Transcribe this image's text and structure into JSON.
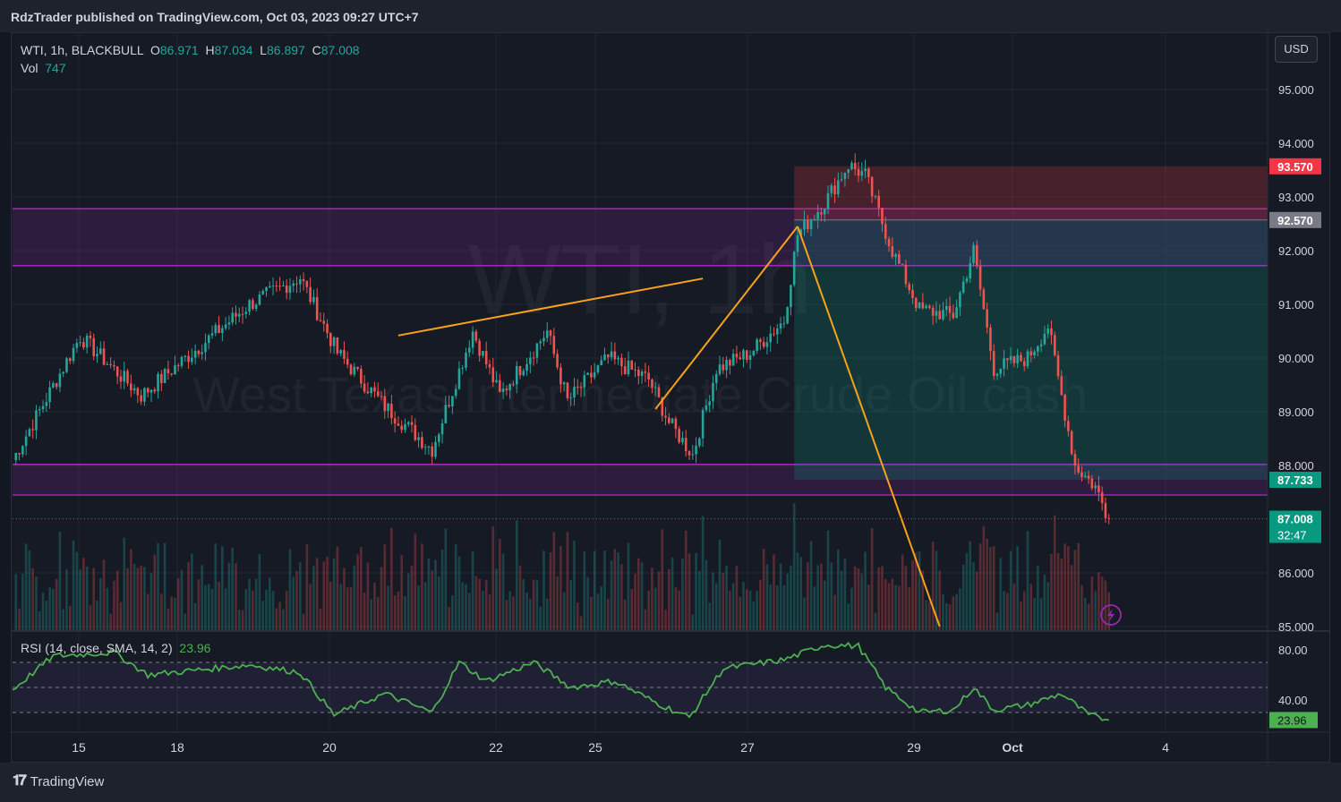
{
  "header": {
    "publisher_line": "RdzTrader published on TradingView.com, Oct 03, 2023 09:27 UTC+7"
  },
  "legend": {
    "symbol_line": "WTI, 1h, BLACKBULL",
    "o_label": "O",
    "o_value": "86.971",
    "h_label": "H",
    "h_value": "87.034",
    "l_label": "L",
    "l_value": "86.897",
    "c_label": "C",
    "c_value": "87.008",
    "vol_label": "Vol",
    "vol_value": "747"
  },
  "currency_button": "USD",
  "watermark": {
    "symbol": "WTI, 1h",
    "name": "West Texas Intermediate Crude Oil cash"
  },
  "rsi_legend": {
    "label": "RSI (14, close, SMA, 14, 2)",
    "value": "23.96"
  },
  "footer": {
    "logo_text": "TradingView"
  },
  "colors": {
    "up": "#26a69a",
    "down": "#ef5350",
    "zone": "#9c27b0",
    "trendline": "#f7a21b",
    "rsi": "#4caf50",
    "background": "#161a25"
  },
  "chart_data": [
    {
      "type": "candlestick",
      "title": "WTI, 1h, BLACKBULL",
      "x_ticks": [
        "15",
        "18",
        "20",
        "22",
        "25",
        "27",
        "29",
        "Oct",
        "4"
      ],
      "y_ticks": [
        "95.000",
        "94.000",
        "93.000",
        "92.000",
        "91.000",
        "90.000",
        "89.000",
        "88.000",
        "86.000",
        "85.000"
      ],
      "ylim": [
        85.0,
        95.7
      ],
      "price_path_anchors": [
        {
          "i": 0,
          "p": 88.1
        },
        {
          "i": 20,
          "p": 90.4
        },
        {
          "i": 38,
          "p": 89.3
        },
        {
          "i": 70,
          "p": 91.0
        },
        {
          "i": 85,
          "p": 91.5
        },
        {
          "i": 96,
          "p": 90.1
        },
        {
          "i": 110,
          "p": 89.1
        },
        {
          "i": 124,
          "p": 88.3
        },
        {
          "i": 136,
          "p": 90.5
        },
        {
          "i": 144,
          "p": 89.3
        },
        {
          "i": 158,
          "p": 90.5
        },
        {
          "i": 164,
          "p": 89.2
        },
        {
          "i": 176,
          "p": 90.0
        },
        {
          "i": 188,
          "p": 89.6
        },
        {
          "i": 194,
          "p": 88.8
        },
        {
          "i": 201,
          "p": 88.2
        },
        {
          "i": 208,
          "p": 89.8
        },
        {
          "i": 218,
          "p": 90.1
        },
        {
          "i": 228,
          "p": 90.7
        },
        {
          "i": 232,
          "p": 92.3
        },
        {
          "i": 240,
          "p": 92.9
        },
        {
          "i": 247,
          "p": 93.6
        },
        {
          "i": 252,
          "p": 93.4
        },
        {
          "i": 260,
          "p": 92.0
        },
        {
          "i": 268,
          "p": 90.9
        },
        {
          "i": 278,
          "p": 90.8
        },
        {
          "i": 284,
          "p": 92.0
        },
        {
          "i": 290,
          "p": 89.8
        },
        {
          "i": 300,
          "p": 90.0
        },
        {
          "i": 306,
          "p": 90.6
        },
        {
          "i": 314,
          "p": 88.0
        },
        {
          "i": 320,
          "p": 87.6
        },
        {
          "i": 324,
          "p": 87.0
        }
      ],
      "zones": [
        {
          "label": "upper resistance zone",
          "top": 92.78,
          "bottom": 91.72
        },
        {
          "label": "lower support zone",
          "top": 88.02,
          "bottom": 87.45
        }
      ],
      "position": {
        "type": "short",
        "stop": 93.57,
        "entry": 92.57,
        "target": 87.733,
        "start_index": 231
      },
      "price_tags": [
        {
          "value": 93.57,
          "label": "93.570",
          "color": "#f23645"
        },
        {
          "value": 92.57,
          "label": "92.570",
          "color": "#787b86"
        },
        {
          "value": 87.733,
          "label": "87.733",
          "color": "#089981"
        },
        {
          "value": 87.008,
          "label": "87.008",
          "sub": "32:47",
          "color": "#089981"
        }
      ],
      "trendlines": [
        {
          "from": {
            "i": 114,
            "p": 90.42
          },
          "to": {
            "i": 204,
            "p": 91.48
          }
        },
        {
          "from": {
            "i": 190,
            "p": 89.05
          },
          "to": {
            "i": 232,
            "p": 92.45
          }
        },
        {
          "from": {
            "i": 232,
            "p": 92.45
          },
          "to": {
            "i": 274,
            "p": 85.0
          }
        }
      ]
    },
    {
      "type": "line",
      "title": "RSI (14, close, SMA, 14, 2)",
      "y_ticks": [
        "80.00",
        "40.00"
      ],
      "levels": [
        70,
        50,
        30
      ],
      "ylim": [
        20,
        85
      ],
      "last_value": 23.96,
      "rsi_anchors": [
        {
          "i": 0,
          "v": 48
        },
        {
          "i": 12,
          "v": 75
        },
        {
          "i": 30,
          "v": 78
        },
        {
          "i": 40,
          "v": 60
        },
        {
          "i": 55,
          "v": 64
        },
        {
          "i": 70,
          "v": 68
        },
        {
          "i": 85,
          "v": 62
        },
        {
          "i": 95,
          "v": 28
        },
        {
          "i": 110,
          "v": 45
        },
        {
          "i": 124,
          "v": 30
        },
        {
          "i": 132,
          "v": 70
        },
        {
          "i": 140,
          "v": 55
        },
        {
          "i": 154,
          "v": 70
        },
        {
          "i": 165,
          "v": 50
        },
        {
          "i": 178,
          "v": 55
        },
        {
          "i": 190,
          "v": 38
        },
        {
          "i": 200,
          "v": 26
        },
        {
          "i": 210,
          "v": 65
        },
        {
          "i": 228,
          "v": 72
        },
        {
          "i": 240,
          "v": 84
        },
        {
          "i": 250,
          "v": 83
        },
        {
          "i": 258,
          "v": 50
        },
        {
          "i": 268,
          "v": 30
        },
        {
          "i": 278,
          "v": 32
        },
        {
          "i": 284,
          "v": 50
        },
        {
          "i": 290,
          "v": 32
        },
        {
          "i": 300,
          "v": 36
        },
        {
          "i": 310,
          "v": 45
        },
        {
          "i": 318,
          "v": 28
        },
        {
          "i": 324,
          "v": 23.96
        }
      ]
    }
  ]
}
